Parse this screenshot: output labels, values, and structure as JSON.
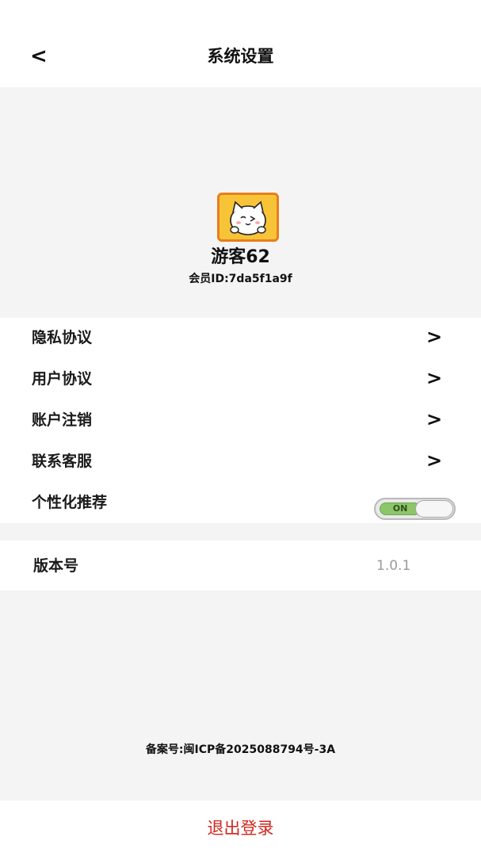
{
  "header": {
    "back_label": "<",
    "title": "系统设置"
  },
  "profile": {
    "avatar_icon": "cat-avatar-icon",
    "username": "游客62",
    "member_id": "会员ID:7da5f1a9f"
  },
  "menu": {
    "items": [
      {
        "label": "隐私协议",
        "chevron": ">"
      },
      {
        "label": "用户协议",
        "chevron": ">"
      },
      {
        "label": "账户注销",
        "chevron": ">"
      },
      {
        "label": "联系客服",
        "chevron": ">"
      }
    ],
    "personalization": {
      "label": "个性化推荐",
      "toggle_text": "ON"
    }
  },
  "version": {
    "label": "版本号",
    "value": "1.0.1"
  },
  "footer": {
    "icp": "备案号:闽ICP备2025088794号-3A",
    "logout_label": "退出登录"
  },
  "colors": {
    "logout": "#d0271d",
    "avatar_bg": "#f7c438",
    "avatar_border": "#e87e1c",
    "toggle_on": "#8dc66a"
  }
}
